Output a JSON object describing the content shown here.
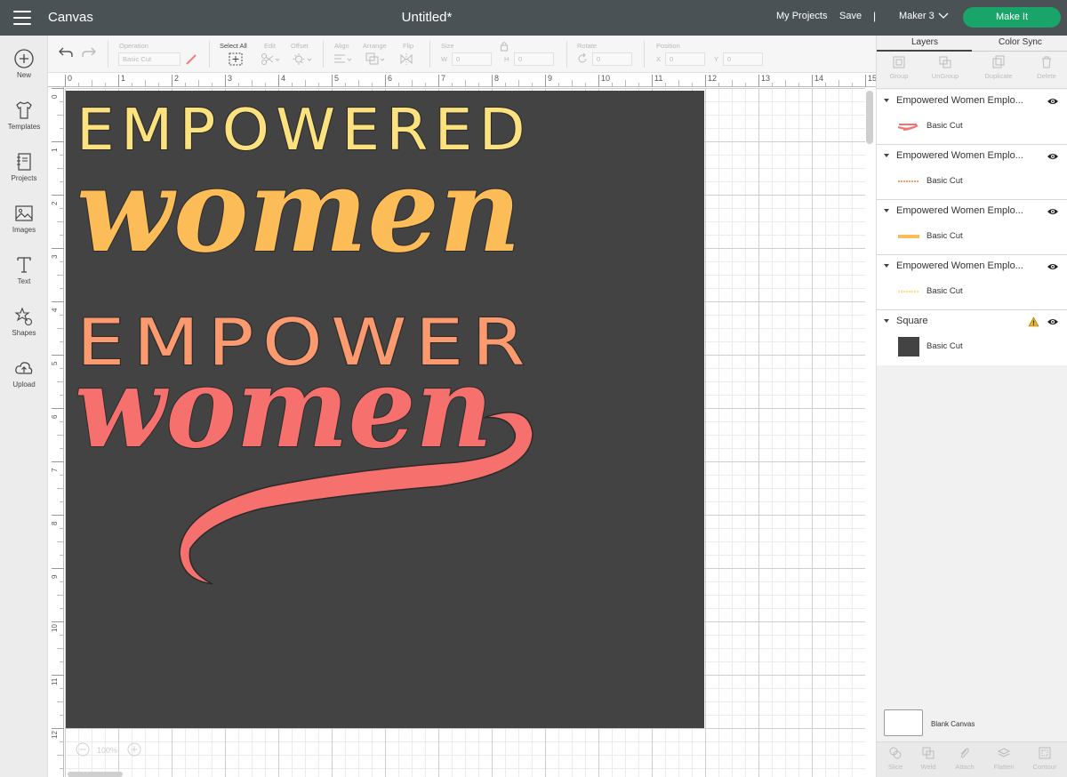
{
  "header": {
    "app_title": "Canvas",
    "doc_title": "Untitled*",
    "my_projects": "My Projects",
    "save": "Save",
    "separator": "|",
    "machine": "Maker 3",
    "make_it": "Make It"
  },
  "sidebar": {
    "items": [
      {
        "label": "New",
        "icon": "plus-circle-icon"
      },
      {
        "label": "Templates",
        "icon": "tshirt-icon"
      },
      {
        "label": "Projects",
        "icon": "notebook-icon"
      },
      {
        "label": "Images",
        "icon": "image-icon"
      },
      {
        "label": "Text",
        "icon": "text-t-icon"
      },
      {
        "label": "Shapes",
        "icon": "shapes-icon"
      },
      {
        "label": "Upload",
        "icon": "cloud-upload-icon"
      }
    ]
  },
  "toolbar": {
    "operation_label": "Operation",
    "operation_value": "Basic Cut",
    "select_all": "Select All",
    "edit": "Edit",
    "offset": "Offset",
    "align": "Align",
    "arrange": "Arrange",
    "flip": "Flip",
    "size": "Size",
    "w": "W",
    "h": "H",
    "w_value": "0",
    "h_value": "0",
    "rotate": "Rotate",
    "rotate_value": "0",
    "position": "Position",
    "x": "X",
    "y": "Y",
    "x_value": "0",
    "y_value": "0"
  },
  "canvas": {
    "ruler_top": [
      "0",
      "1",
      "2",
      "3",
      "4",
      "5",
      "6",
      "7",
      "8",
      "9",
      "10",
      "11",
      "12",
      "13",
      "14",
      "15"
    ],
    "ruler_left": [
      "0",
      "1",
      "2",
      "3",
      "4",
      "5",
      "6",
      "7",
      "8",
      "9",
      "10",
      "11",
      "12"
    ],
    "zoom": "100%",
    "artwork": {
      "line1": "EMPOWERED",
      "line2": "women",
      "line3": "EMPOWER",
      "line4": "women"
    }
  },
  "colors": {
    "header_bg": "#4a5256",
    "make_it_green": "#19a56a",
    "artboard": "#434343",
    "yellow": "#fce27e",
    "orange_yellow": "#fcbd58",
    "salmon": "#fa9a6e",
    "coral": "#f6716e"
  },
  "right_panel": {
    "tabs": [
      "Layers",
      "Color Sync"
    ],
    "actions": [
      "Group",
      "UnGroup",
      "Duplicate",
      "Delete"
    ],
    "layers": [
      {
        "title": "Empowered Women Emplo...",
        "op": "Basic Cut"
      },
      {
        "title": "Empowered Women Emplo...",
        "op": "Basic Cut"
      },
      {
        "title": "Empowered Women Emplo...",
        "op": "Basic Cut"
      },
      {
        "title": "Empowered Women Emplo...",
        "op": "Basic Cut"
      },
      {
        "title": "Square",
        "op": "Basic Cut"
      }
    ],
    "blank_canvas": "Blank Canvas",
    "bottom_actions": [
      "Slice",
      "Weld",
      "Attach",
      "Flatten",
      "Contour"
    ]
  }
}
